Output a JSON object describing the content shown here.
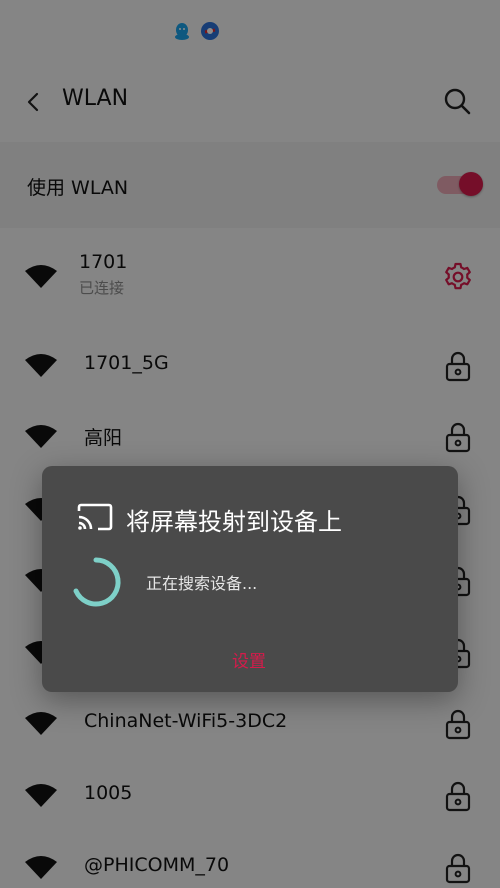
{
  "header": {
    "title": "WLAN"
  },
  "toggle": {
    "label": "使用 WLAN",
    "enabled": true
  },
  "accent_color": "#d51b4b",
  "networks": [
    {
      "name": "1701",
      "status": "已连接",
      "action_icon": "gear-icon"
    },
    {
      "name": "1701_5G",
      "action_icon": "lock-icon"
    },
    {
      "name": "高阳",
      "action_icon": "lock-icon"
    },
    {
      "name": "ChinaNet-WiFi5-3DC2",
      "action_icon": "lock-icon"
    },
    {
      "name": "1005",
      "action_icon": "lock-icon"
    },
    {
      "name": "@PHICOMM_70",
      "action_icon": "lock-icon"
    }
  ],
  "dialog": {
    "title": "将屏幕投射到设备上",
    "status": "正在搜索设备...",
    "settings_label": "设置",
    "icon": "cast-icon"
  }
}
